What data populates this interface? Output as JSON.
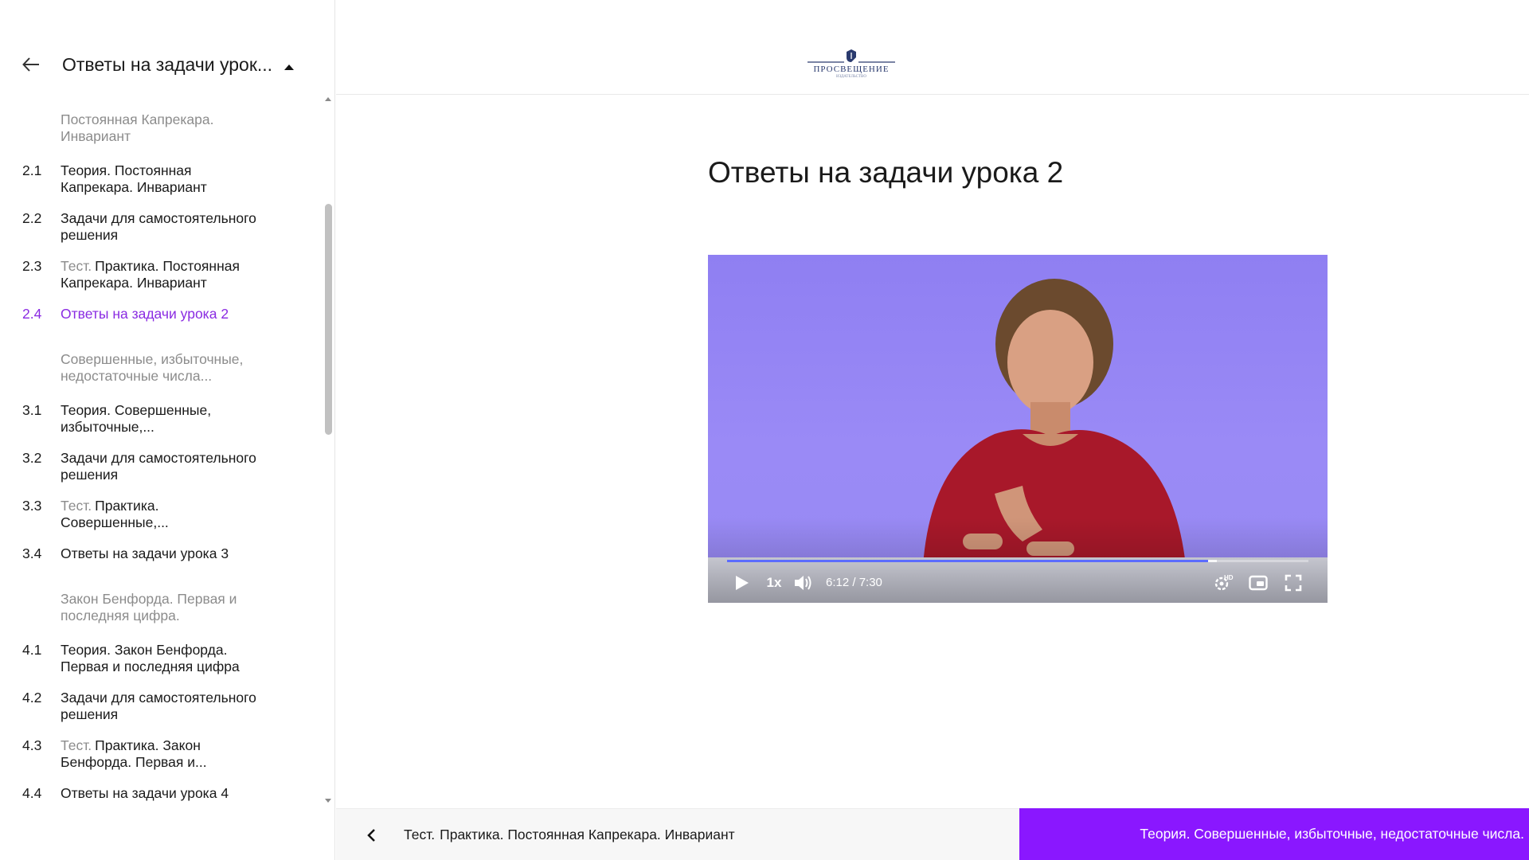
{
  "sidebar": {
    "title": "Ответы на задачи урок...",
    "sections": [
      {
        "label": "Постоянная Капрекара. Инвариант",
        "items": [
          {
            "num": "2.1",
            "tag": "",
            "text": "Теория. Постоянная Капрекара. Инвариант"
          },
          {
            "num": "2.2",
            "tag": "",
            "text": "Задачи для самостоятельного решения"
          },
          {
            "num": "2.3",
            "tag": "Тест.",
            "text": "Практика. Постоянная Капрекара. Инвариант"
          },
          {
            "num": "2.4",
            "tag": "",
            "text": "Ответы на задачи урока 2",
            "active": true
          }
        ]
      },
      {
        "label": "Совершенные, избыточные, недостаточные числа...",
        "items": [
          {
            "num": "3.1",
            "tag": "",
            "text": "Теория. Совершенные, избыточные,..."
          },
          {
            "num": "3.2",
            "tag": "",
            "text": "Задачи для самостоятельного решения"
          },
          {
            "num": "3.3",
            "tag": "Тест.",
            "text": "Практика. Совершенные,..."
          },
          {
            "num": "3.4",
            "tag": "",
            "text": "Ответы на задачи урока 3"
          }
        ]
      },
      {
        "label": "Закон Бенфорда. Первая и последняя цифра.",
        "items": [
          {
            "num": "4.1",
            "tag": "",
            "text": "Теория. Закон Бенфорда. Первая и последняя цифра"
          },
          {
            "num": "4.2",
            "tag": "",
            "text": "Задачи для самостоятельного решения"
          },
          {
            "num": "4.3",
            "tag": "Тест.",
            "text": "Практика. Закон Бенфорда. Первая и..."
          },
          {
            "num": "4.4",
            "tag": "",
            "text": "Ответы на задачи урока 4"
          }
        ]
      }
    ]
  },
  "header": {
    "logo_text": "ПРОСВЕЩЕНИЕ",
    "logo_sub": "ИЗДАТЕЛЬСТВО",
    "page_title": "Ответы на задачи урока 2"
  },
  "player": {
    "speed": "1x",
    "time": "6:12 / 7:30",
    "progress_fraction": 0.827,
    "buffer_start_fraction": 0.827,
    "buffer_end_fraction": 0.842
  },
  "nav": {
    "prev_tag": "Тест.",
    "prev_label": "Практика. Постоянная Капрекара. Инвариант",
    "next_label": "Теория. Совершенные, избыточные, недостаточные числа."
  },
  "colors": {
    "accent": "#8a17ff",
    "active_text": "#8a2be2",
    "muted": "#8c8c8c"
  }
}
